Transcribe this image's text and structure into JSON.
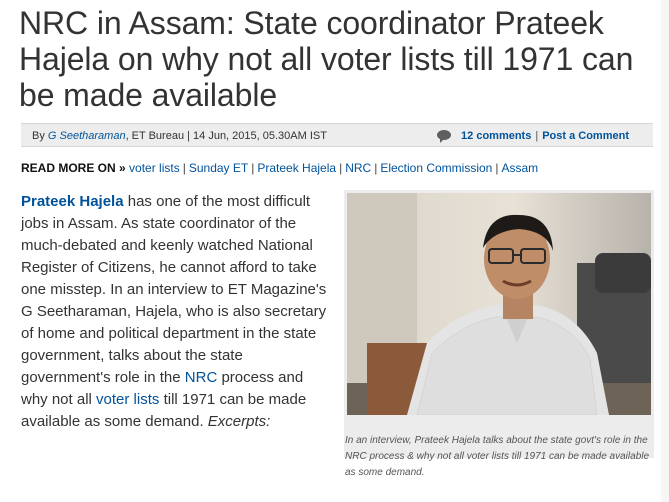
{
  "headline": "NRC in Assam: State coordinator Prateek Hajela on why not all voter lists till 1971 can be made available",
  "byline": {
    "by": "By",
    "author": "G Seetharaman",
    "source_date": ", ET Bureau | 14 Jun, 2015, 05.30AM IST",
    "comments": "12 comments",
    "separator": "|",
    "post_comment": "Post a Comment"
  },
  "read_more": {
    "label": "READ MORE ON »",
    "tags": [
      "voter lists",
      "Sunday ET",
      "Prateek Hajela",
      "NRC",
      "Election Commission",
      "Assam"
    ]
  },
  "article": {
    "name": "Prateek Hajela",
    "text1": " has one of the most difficult jobs in Assam. As state coordinator of the much-debated and keenly watched National Register of Citizens, he cannot afford to take one misstep. In an interview to ET Magazine's G Seetharaman, Hajela, who is also secretary of home and political department in the state government, talks about the state government's role in the ",
    "link_nrc": "NRC",
    "text2": " process and why not all ",
    "link_voter": "voter lists",
    "text3": " till 1971 can be made available as some demand. ",
    "excerpts": "Excerpts:"
  },
  "caption": "In an interview, Prateek Hajela talks about the state govt's role in the NRC process & why not all voter lists till 1971 can be made available as some demand."
}
